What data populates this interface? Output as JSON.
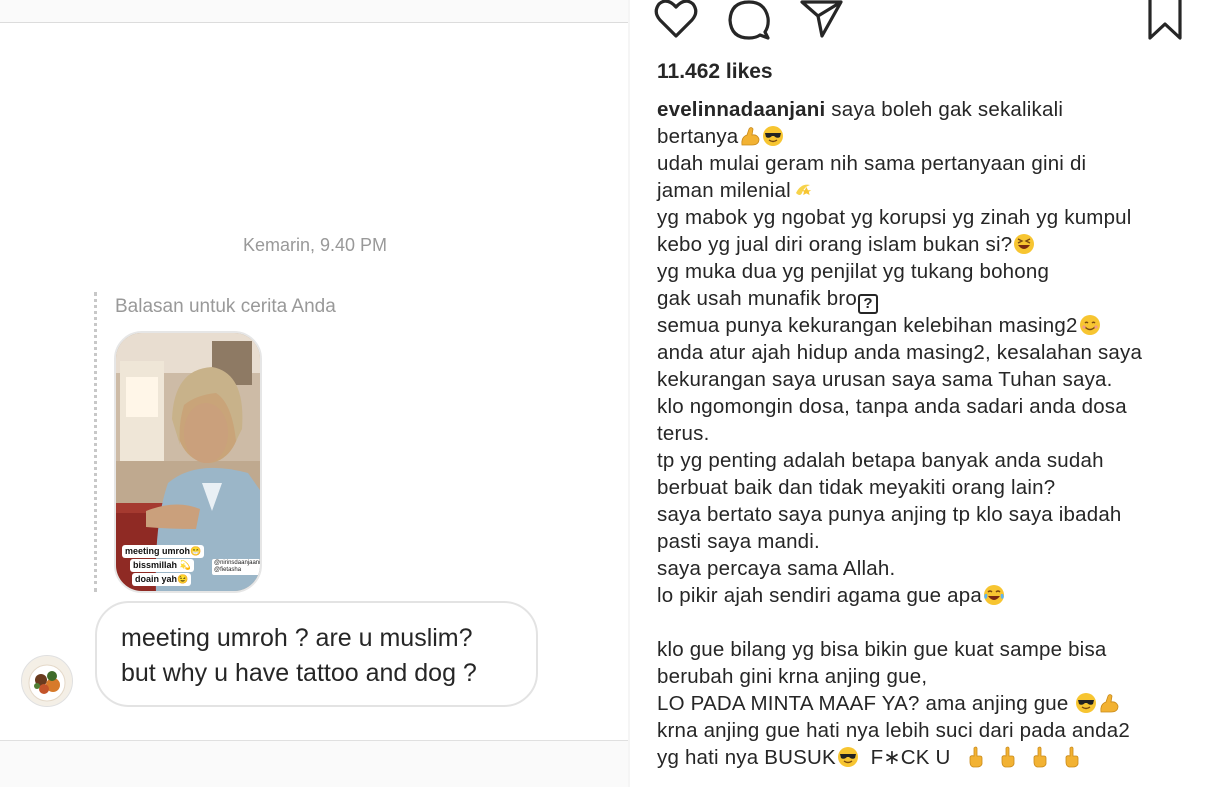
{
  "dm": {
    "timestamp": "Kemarin, 9.40 PM",
    "reply_label": "Balasan untuk cerita Anda",
    "story": {
      "caption_lines": [
        "meeting umroh😁",
        "bissmillah 💫",
        "doain yah😉"
      ],
      "mentions": [
        "@nirinsdaanjaani",
        "@fietasha"
      ]
    },
    "message_lines": [
      "meeting umroh ? are u muslim?",
      "but why u have tattoo and dog ?"
    ]
  },
  "post": {
    "icons": [
      "heart-icon",
      "comment-icon",
      "share-icon",
      "bookmark-icon"
    ],
    "likes": "11.462 likes",
    "username": "evelinnadaanjani",
    "caption_lines": [
      {
        "text": " saya boleh gak sekalikali",
        "emoji": []
      },
      {
        "text": "bertanya",
        "emoji": [
          "flexed-biceps",
          "sunglasses-face"
        ]
      },
      {
        "text": "udah mulai geram nih sama pertanyaan gini di",
        "emoji": []
      },
      {
        "text": "jaman milenial",
        "emoji": [
          "dizzy"
        ]
      },
      {
        "text": "yg mabok yg ngobat yg korupsi yg zinah yg kumpul",
        "emoji": []
      },
      {
        "text": "kebo yg jual diri orang islam bukan si?",
        "emoji": [
          "grinning-squinting-face"
        ]
      },
      {
        "text": "yg muka dua yg penjilat yg tukang bohong",
        "emoji": []
      },
      {
        "text": "gak usah munafik bro",
        "emoji": [
          "unknown-glyph"
        ]
      },
      {
        "text": "semua punya kekurangan kelebihan masing2",
        "emoji": [
          "smiling-face"
        ]
      },
      {
        "text": "anda atur ajah hidup anda masing2, kesalahan saya",
        "emoji": []
      },
      {
        "text": "kekurangan saya urusan saya sama Tuhan saya.",
        "emoji": []
      },
      {
        "text": "klo ngomongin dosa, tanpa anda sadari anda dosa",
        "emoji": []
      },
      {
        "text": "terus.",
        "emoji": []
      },
      {
        "text": "tp yg penting adalah betapa banyak anda sudah",
        "emoji": []
      },
      {
        "text": "berbuat baik dan tidak meyakiti orang lain?",
        "emoji": []
      },
      {
        "text": "saya bertato saya punya anjing tp klo saya ibadah",
        "emoji": []
      },
      {
        "text": "pasti saya mandi.",
        "emoji": []
      },
      {
        "text": "saya percaya sama Allah.",
        "emoji": []
      },
      {
        "text": "lo pikir ajah sendiri agama gue apa",
        "emoji": [
          "tears-of-joy"
        ]
      },
      {
        "text": "",
        "emoji": []
      },
      {
        "text": "klo gue bilang yg bisa bikin gue kuat sampe bisa",
        "emoji": []
      },
      {
        "text": "berubah gini krna anjing gue,",
        "emoji": []
      },
      {
        "text": "LO PADA MINTA MAAF YA? ama anjing gue ",
        "emoji": [
          "sunglasses-face",
          "flexed-biceps"
        ]
      },
      {
        "text": "krna anjing gue hati nya lebih suci dari pada anda2",
        "emoji": []
      },
      {
        "text": "yg hati nya BUSUK",
        "emoji": [
          "sunglasses-face"
        ],
        "suffix": "  F∗CK U",
        "suffix_emoji": [
          "middle-finger",
          "middle-finger",
          "middle-finger",
          "middle-finger"
        ]
      }
    ]
  },
  "colors": {
    "text": "#262626",
    "muted": "#999999",
    "emoji_yellow": "#f7c531"
  }
}
